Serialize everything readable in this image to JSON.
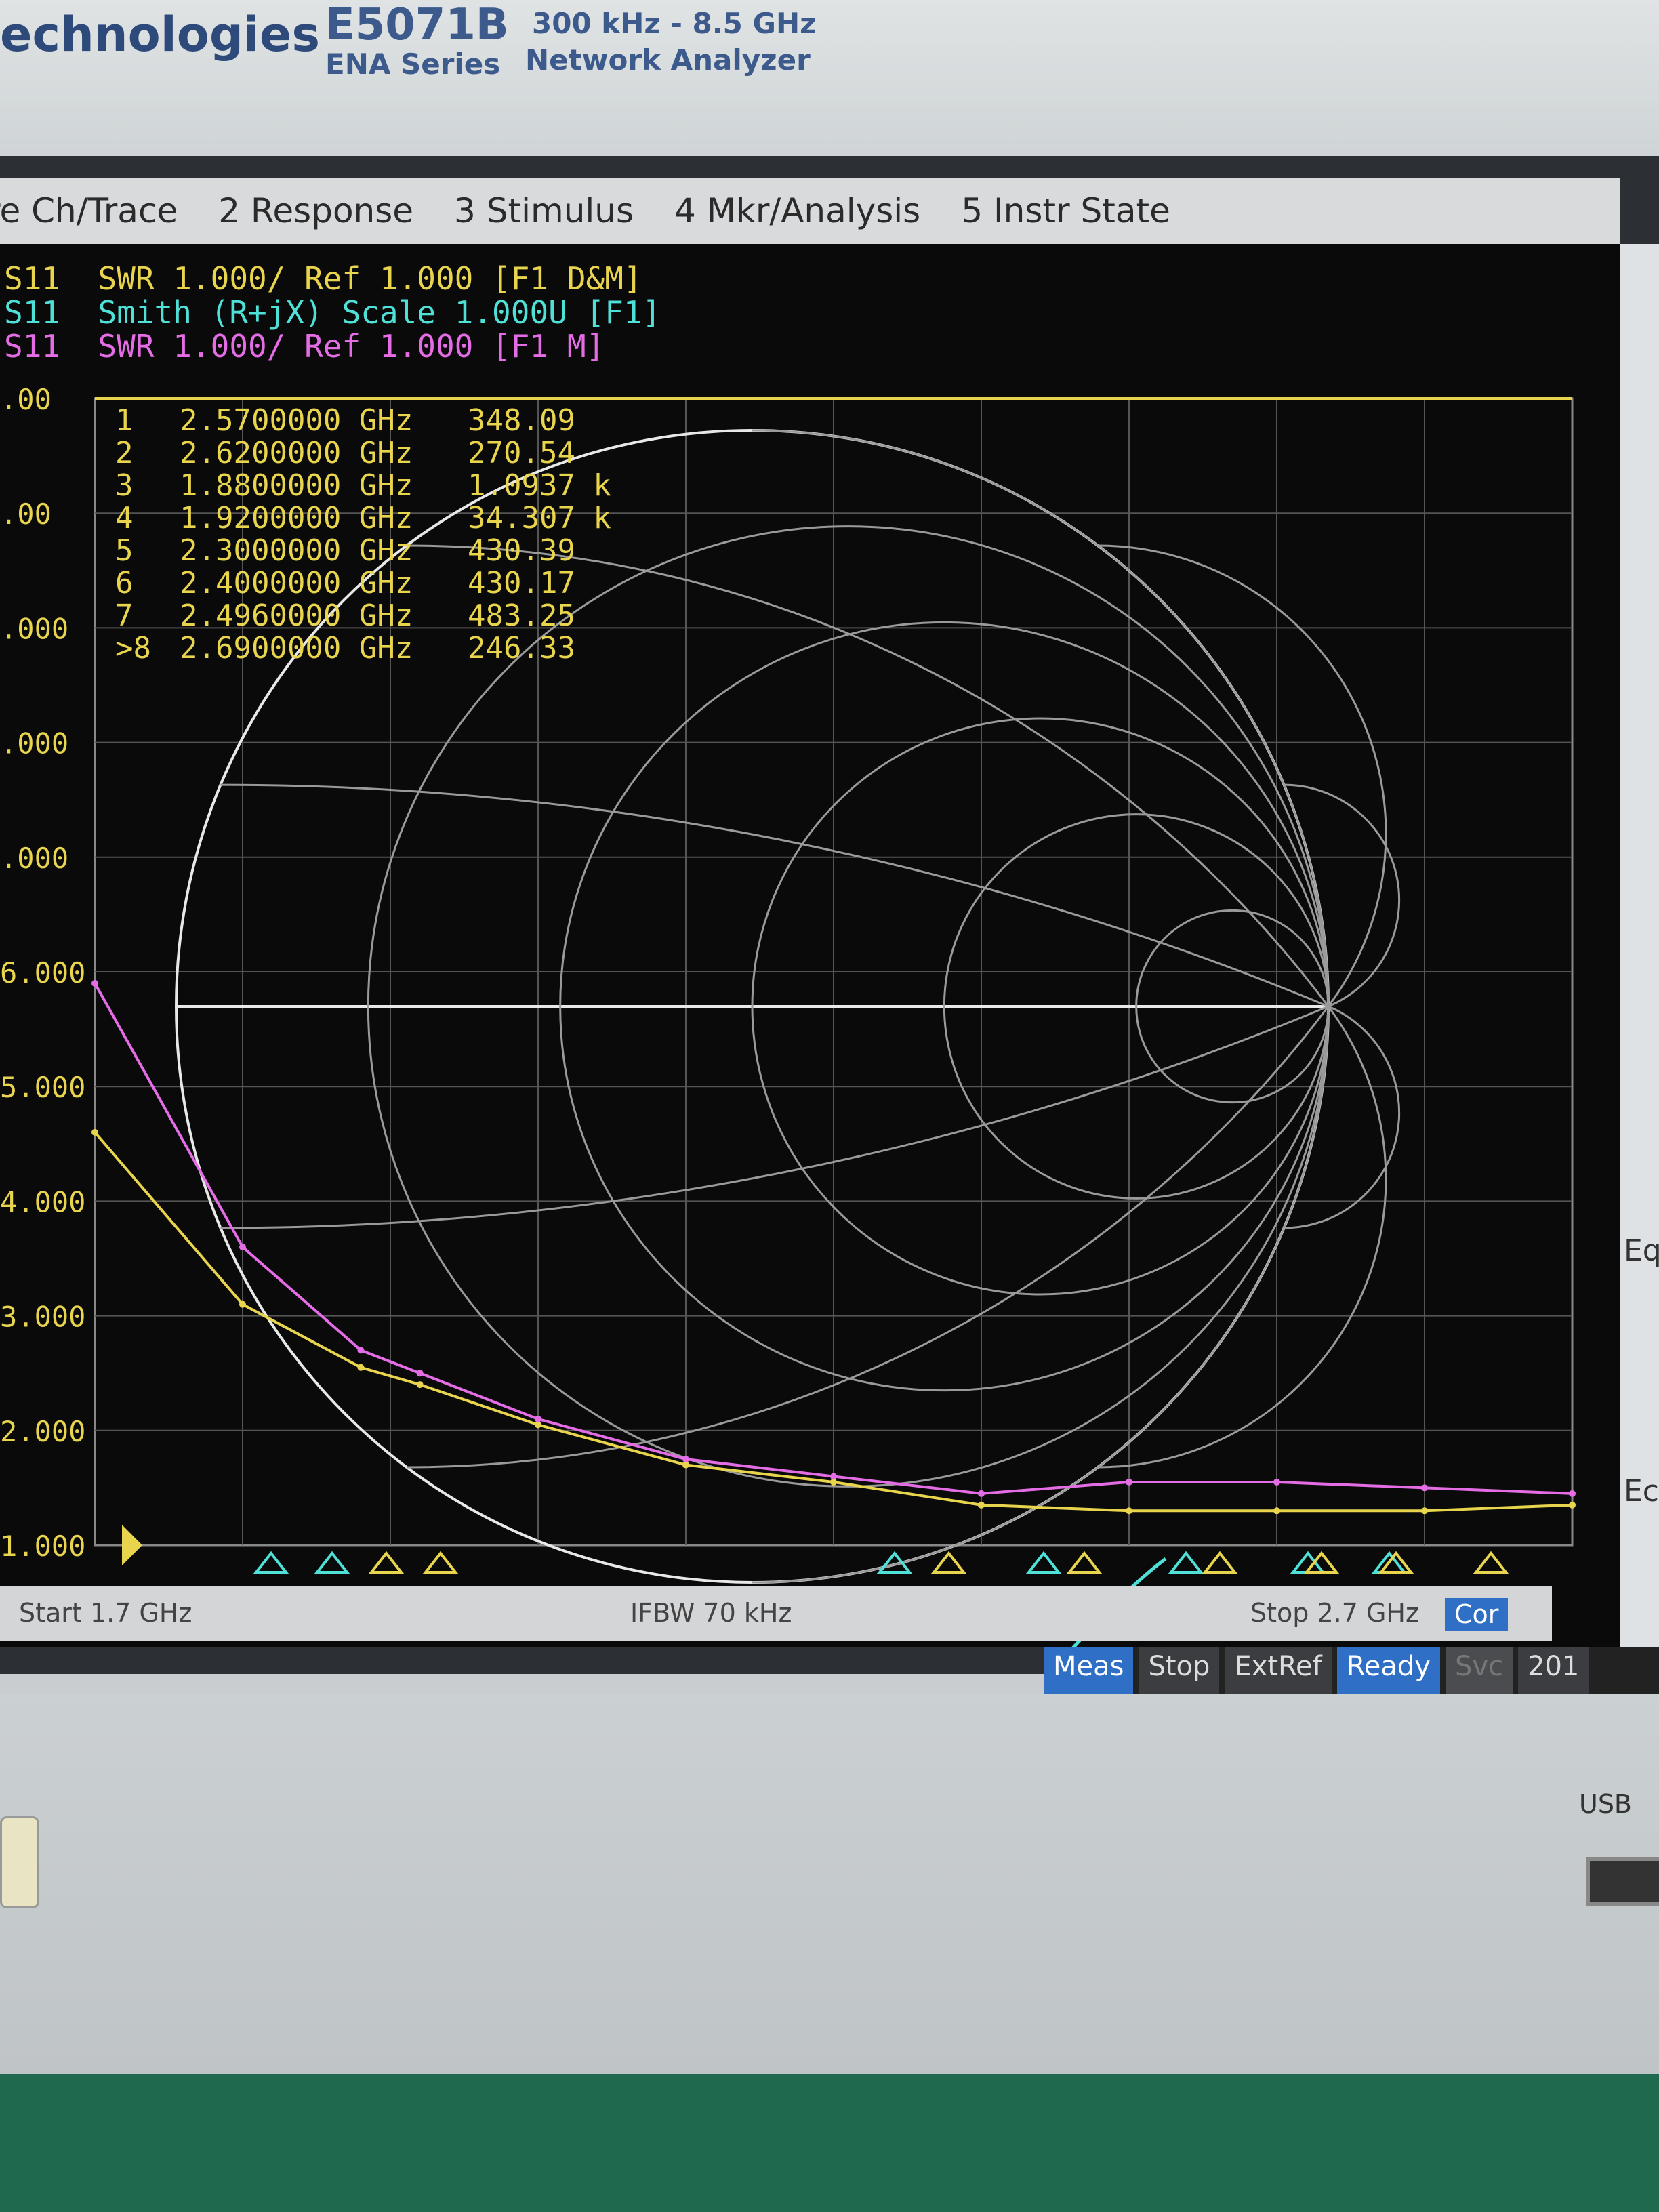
{
  "bezel": {
    "brand": "echnologies",
    "model": "E5071B",
    "series": "ENA  Series",
    "freq_range": "300 kHz - 8.5 GHz",
    "product_type": "Network Analyzer"
  },
  "menu": [
    "re Ch/Trace",
    "2 Response",
    "3 Stimulus",
    "4 Mkr/Analysis",
    "5 Instr State"
  ],
  "traces": [
    {
      "label": "S11  SWR 1.000/ Ref 1.000 [F1 D&M]",
      "color": "#e9d54d"
    },
    {
      "label": "S11  Smith (R+jX) Scale 1.000U [F1]",
      "color": "#4fe0d8"
    },
    {
      "label": "S11  SWR 1.000/ Ref 1.000 [F1 M]",
      "color": "#e46de6"
    }
  ],
  "y_axis_labels": [
    ".00",
    ".00",
    ".000",
    ".000",
    ".000",
    "6.000",
    "5.000",
    "4.000",
    "3.000",
    "2.000",
    "1.000"
  ],
  "marker_table": [
    {
      "num": "1",
      "freq": "2.5700000 GHz",
      "value": "348.09",
      "unit": ""
    },
    {
      "num": "2",
      "freq": "2.6200000 GHz",
      "value": "270.54",
      "unit": ""
    },
    {
      "num": "3",
      "freq": "1.8800000 GHz",
      "value": "1.0937",
      "unit": "k"
    },
    {
      "num": "4",
      "freq": "1.9200000 GHz",
      "value": "34.307",
      "unit": "k"
    },
    {
      "num": "5",
      "freq": "2.3000000 GHz",
      "value": "430.39",
      "unit": ""
    },
    {
      "num": "6",
      "freq": "2.4000000 GHz",
      "value": "430.17",
      "unit": ""
    },
    {
      "num": "7",
      "freq": "2.4960000 GHz",
      "value": "483.25",
      "unit": ""
    },
    {
      "num": ">8",
      "freq": "2.6900000 GHz",
      "value": "246.33",
      "unit": ""
    }
  ],
  "bottom": {
    "start": "Start 1.7 GHz",
    "ifbw": "IFBW 70 kHz",
    "stop": "Stop 2.7 GHz",
    "cor": "Cor"
  },
  "status": [
    "Meas",
    "Stop",
    "ExtRef",
    "Ready",
    "Svc",
    "201"
  ],
  "softkeys": [
    "Eq",
    "Ec"
  ],
  "usb_label": "USB",
  "chart_data": {
    "type": "line",
    "title": "",
    "xlabel": "",
    "ylabel": "",
    "x_range_ghz": [
      1.7,
      2.7
    ],
    "ylim": [
      1.0,
      11.0
    ],
    "grid": true,
    "series": [
      {
        "name": "S11 SWR [F1 D&M]",
        "color": "#e9d54d",
        "x": [
          1.7,
          1.8,
          1.88,
          1.92,
          2.0,
          2.1,
          2.2,
          2.3,
          2.4,
          2.5,
          2.6,
          2.7
        ],
        "values": [
          4.6,
          3.1,
          2.55,
          2.4,
          2.05,
          1.7,
          1.55,
          1.35,
          1.3,
          1.3,
          1.3,
          1.35
        ]
      },
      {
        "name": "S11 SWR [F1 M]",
        "color": "#e46de6",
        "x": [
          1.7,
          1.8,
          1.88,
          1.92,
          2.0,
          2.1,
          2.2,
          2.3,
          2.4,
          2.5,
          2.6,
          2.7
        ],
        "values": [
          5.9,
          3.6,
          2.7,
          2.5,
          2.1,
          1.75,
          1.6,
          1.45,
          1.55,
          1.55,
          1.5,
          1.45
        ]
      }
    ]
  }
}
